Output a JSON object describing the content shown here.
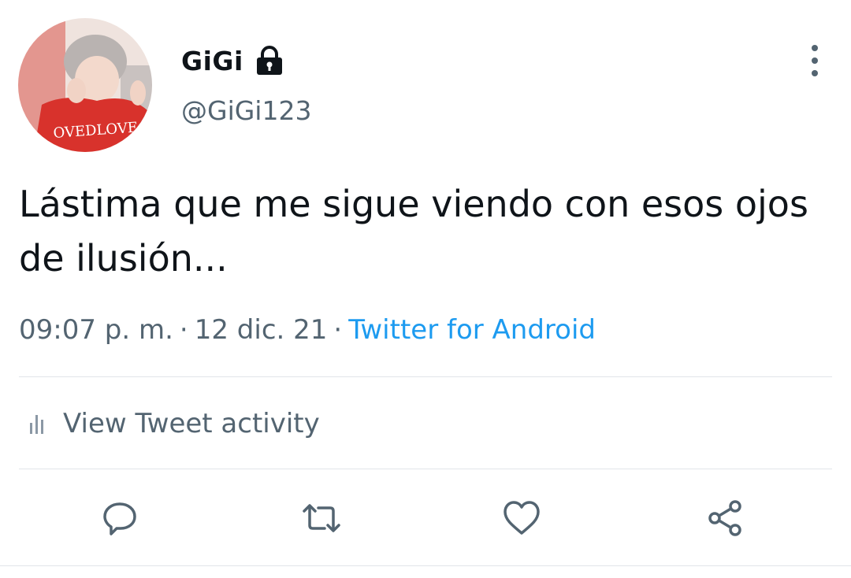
{
  "tweet": {
    "author": {
      "display_name": "GiGi",
      "handle": "@GiGi123",
      "protected_icon": "lock-icon",
      "avatar_shirt_text": "OVEDLOVE"
    },
    "text": "Lástima que me sigue viendo con esos ojos de ilusión...",
    "time": "09:07 p. m.",
    "separator": "·",
    "date": "12 dic. 21",
    "source": "Twitter for Android"
  },
  "activity": {
    "icon": "bar-chart-icon",
    "label": "View Tweet activity"
  },
  "actions": [
    {
      "name": "reply",
      "icon": "reply-icon"
    },
    {
      "name": "retweet",
      "icon": "retweet-icon"
    },
    {
      "name": "like",
      "icon": "heart-icon"
    },
    {
      "name": "share",
      "icon": "share-icon"
    }
  ],
  "colors": {
    "text_primary": "#0f1419",
    "text_secondary": "#536471",
    "link": "#1d9bf0",
    "divider": "#e1e5e9"
  }
}
